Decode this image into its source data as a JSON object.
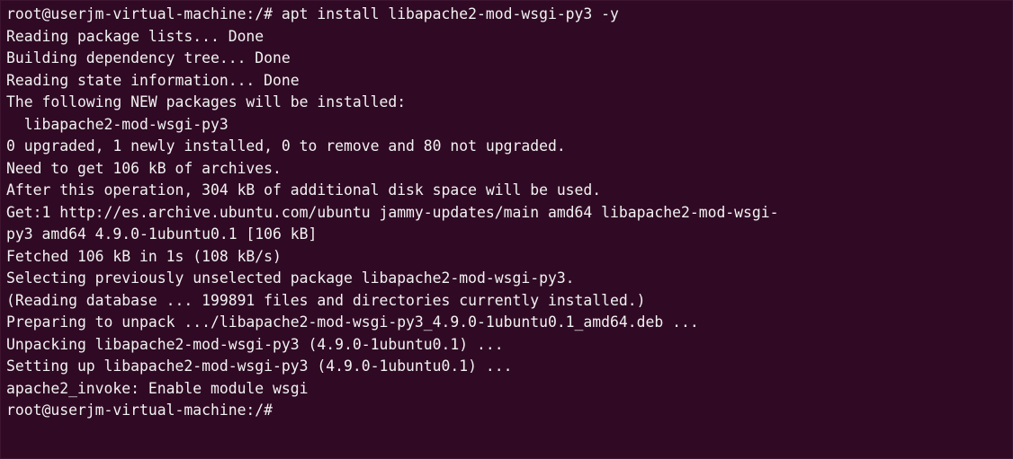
{
  "terminal": {
    "background": "#300a24",
    "foreground": "#f2f2f2",
    "lines": [
      "root@userjm-virtual-machine:/# apt install libapache2-mod-wsgi-py3 -y",
      "Reading package lists... Done",
      "Building dependency tree... Done",
      "Reading state information... Done",
      "The following NEW packages will be installed:",
      "  libapache2-mod-wsgi-py3",
      "0 upgraded, 1 newly installed, 0 to remove and 80 not upgraded.",
      "Need to get 106 kB of archives.",
      "After this operation, 304 kB of additional disk space will be used.",
      "Get:1 http://es.archive.ubuntu.com/ubuntu jammy-updates/main amd64 libapache2-mod-wsgi-",
      "py3 amd64 4.9.0-1ubuntu0.1 [106 kB]",
      "Fetched 106 kB in 1s (108 kB/s)",
      "Selecting previously unselected package libapache2-mod-wsgi-py3.",
      "(Reading database ... 199891 files and directories currently installed.)",
      "Preparing to unpack .../libapache2-mod-wsgi-py3_4.9.0-1ubuntu0.1_amd64.deb ...",
      "Unpacking libapache2-mod-wsgi-py3 (4.9.0-1ubuntu0.1) ...",
      "Setting up libapache2-mod-wsgi-py3 (4.9.0-1ubuntu0.1) ...",
      "apache2_invoke: Enable module wsgi"
    ],
    "prompt": "root@userjm-virtual-machine:/# "
  }
}
